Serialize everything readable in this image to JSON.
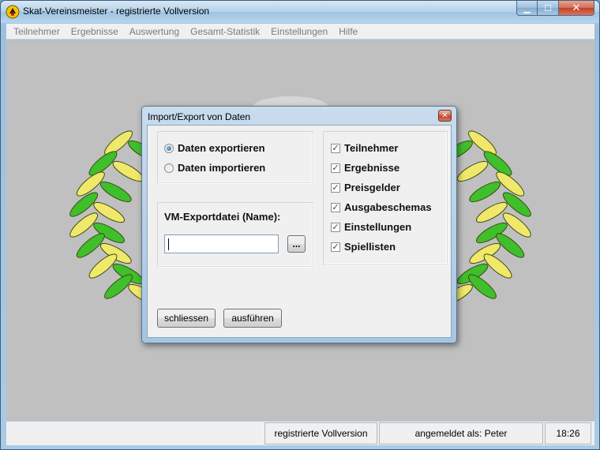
{
  "window": {
    "title": "Skat-Vereinsmeister - registrierte Vollversion",
    "minimize_glyph": "▁",
    "maximize_glyph": "☐",
    "close_glyph": "✕"
  },
  "menu": [
    "Teilnehmer",
    "Ergebnisse",
    "Auswertung",
    "Gesamt-Statistik",
    "Einstellungen",
    "Hilfe"
  ],
  "dialog": {
    "title": "Import/Export von Daten",
    "close_glyph": "✕",
    "mode": {
      "export_label": "Daten exportieren",
      "import_label": "Daten importieren",
      "selected": "export"
    },
    "file": {
      "label": "VM-Exportdatei (Name):",
      "value": "",
      "browse_label": "..."
    },
    "checks": [
      {
        "label": "Teilnehmer",
        "checked": true
      },
      {
        "label": "Ergebnisse",
        "checked": true
      },
      {
        "label": "Preisgelder",
        "checked": true
      },
      {
        "label": "Ausgabeschemas",
        "checked": true
      },
      {
        "label": "Einstellungen",
        "checked": true
      },
      {
        "label": "Spiellisten",
        "checked": true
      }
    ],
    "check_glyph": "✓",
    "close_button": "schliessen",
    "run_button": "ausführen"
  },
  "status": {
    "edition": "registrierte Vollversion",
    "user": "angemeldet als: Peter",
    "time": "18:26"
  },
  "colors": {
    "client_bg": "#c0c0c0",
    "leaf_yellow": "#f0e86a",
    "leaf_green": "#3fbf2a"
  }
}
